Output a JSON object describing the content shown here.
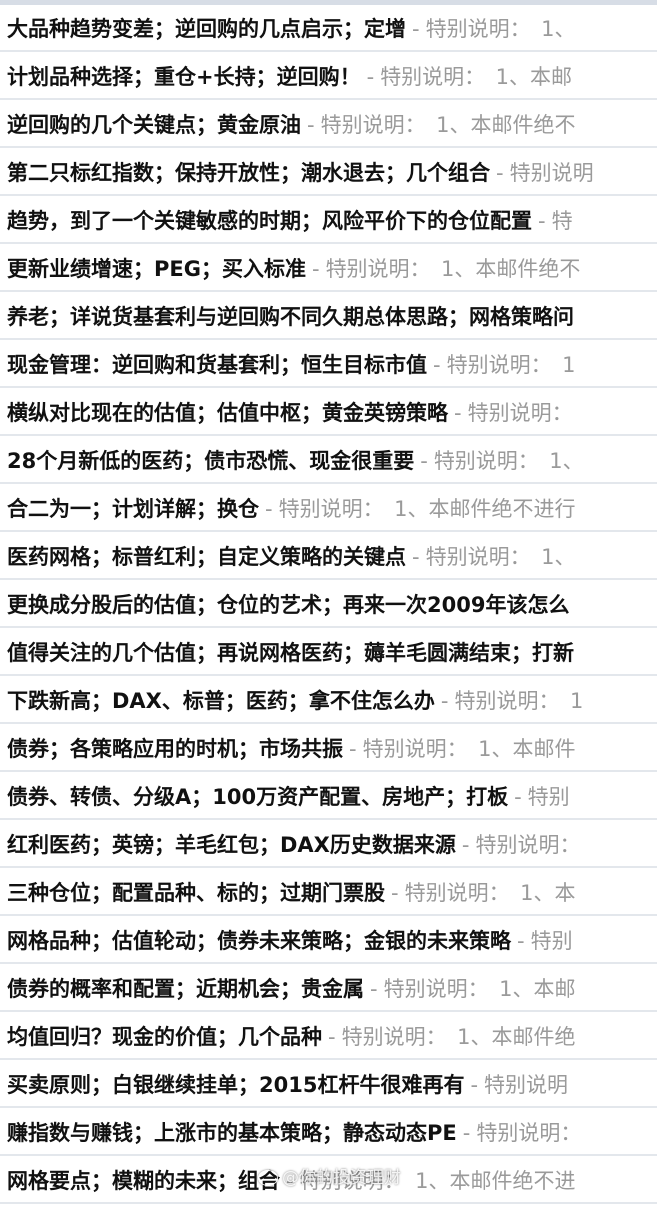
{
  "separator": "-",
  "snippet_prefix": "特别说明：",
  "emails": [
    {
      "subject": "大品种趋势变差；逆回购的几点启示；定增",
      "snippet": "特别说明：　1、"
    },
    {
      "subject": "计划品种选择；重仓+长持；逆回购！",
      "snippet": "特别说明：　1、本邮"
    },
    {
      "subject": "逆回购的几个关键点；黄金原油",
      "snippet": "特别说明：　1、本邮件绝不"
    },
    {
      "subject": "第二只标红指数；保持开放性；潮水退去；几个组合",
      "snippet": "特别说明"
    },
    {
      "subject": "趋势，到了一个关键敏感的时期；风险平价下的仓位配置",
      "snippet": "特"
    },
    {
      "subject": "更新业绩增速；PEG；买入标准",
      "snippet": "特别说明：　1、本邮件绝不"
    },
    {
      "subject": "养老；详说货基套利与逆回购不同久期总体思路；网格策略问",
      "snippet": ""
    },
    {
      "subject": "现金管理：逆回购和货基套利；恒生目标市值",
      "snippet": "特别说明：　1"
    },
    {
      "subject": "横纵对比现在的估值；估值中枢；黄金英镑策略",
      "snippet": "特别说明："
    },
    {
      "subject": "28个月新低的医药；债市恐慌、现金很重要",
      "snippet": "特别说明：　1、"
    },
    {
      "subject": "合二为一；计划详解；换仓",
      "snippet": "特别说明：　1、本邮件绝不进行"
    },
    {
      "subject": "医药网格；标普红利；自定义策略的关键点",
      "snippet": "特别说明：　1、"
    },
    {
      "subject": "更换成分股后的估值；仓位的艺术；再来一次2009年该怎么",
      "snippet": ""
    },
    {
      "subject": "值得关注的几个估值；再说网格医药；薅羊毛圆满结束；打新",
      "snippet": ""
    },
    {
      "subject": "下跌新高；DAX、标普；医药；拿不住怎么办",
      "snippet": "特别说明：　1"
    },
    {
      "subject": "债券；各策略应用的时机；市场共振",
      "snippet": "特别说明：　1、本邮件"
    },
    {
      "subject": "债券、转债、分级A；100万资产配置、房地产；打板",
      "snippet": "特别"
    },
    {
      "subject": "红利医药；英镑；羊毛红包；DAX历史数据来源",
      "snippet": "特别说明："
    },
    {
      "subject": "三种仓位；配置品种、标的；过期门票股",
      "snippet": "特别说明：　1、本"
    },
    {
      "subject": "网格品种；估值轮动；债券未来策略；金银的未来策略",
      "snippet": "特别"
    },
    {
      "subject": "债券的概率和配置；近期机会；贵金属",
      "snippet": "特别说明：　1、本邮"
    },
    {
      "subject": "均值回归？现金的价值；几个品种",
      "snippet": "特别说明：　1、本邮件绝"
    },
    {
      "subject": "买卖原则；白银继续挂单；2015杠杆牛很难再有",
      "snippet": "特别说明"
    },
    {
      "subject": "赚指数与赚钱；上涨市的基本策略；静态动态PE",
      "snippet": "特别说明："
    },
    {
      "subject": "网格要点；模糊的未来；组合",
      "snippet": "特别说明：　1、本邮件绝不进"
    }
  ],
  "watermark": {
    "text": "@你的投资理财"
  }
}
